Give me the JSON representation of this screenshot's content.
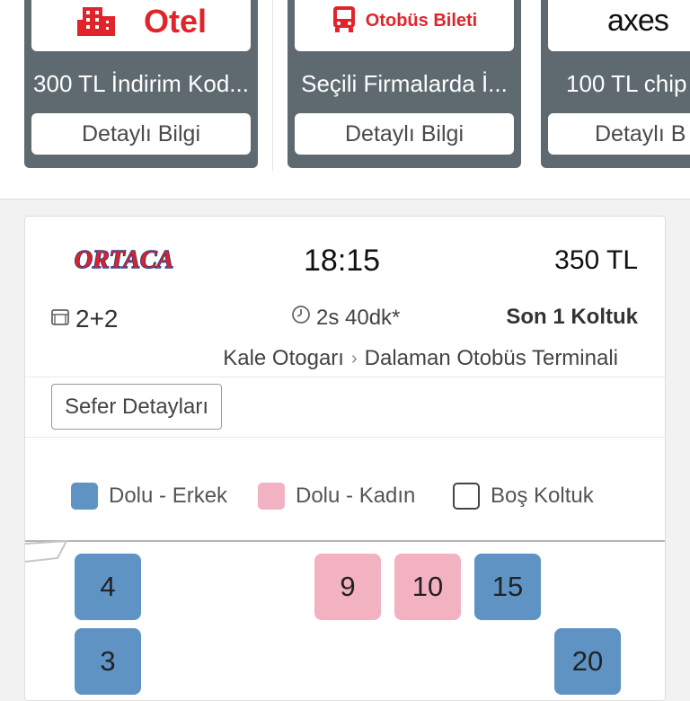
{
  "promos": [
    {
      "logo_text": "Otel",
      "title": "300 TL İndirim Kod...",
      "button": "Detaylı Bilgi"
    },
    {
      "logo_text": "Otobüs Bileti",
      "title": "Seçili Firmalarda İ...",
      "button": "Detaylı Bilgi"
    },
    {
      "logo_text": "axes",
      "title": "100 TL chip",
      "button": "Detaylı B"
    }
  ],
  "trip": {
    "company": "ORTACA",
    "departure_time": "18:15",
    "price": "350 TL",
    "seat_layout": "2+2",
    "duration": "2s 40dk*",
    "seats_left": "Son 1 Koltuk",
    "origin": "Kale Otogarı",
    "destination": "Dalaman Otobüs Terminali",
    "details_button": "Sefer Detayları"
  },
  "legend": {
    "male": "Dolu - Erkek",
    "female": "Dolu - Kadın",
    "empty": "Boş Koltuk"
  },
  "seats": [
    {
      "number": "4",
      "status": "male"
    },
    {
      "number": "9",
      "status": "female"
    },
    {
      "number": "10",
      "status": "female"
    },
    {
      "number": "15",
      "status": "male"
    },
    {
      "number": "3",
      "status": "male"
    },
    {
      "number": "20",
      "status": "male"
    }
  ],
  "colors": {
    "male": "#5e93c4",
    "female": "#f2b2c1",
    "brand_red": "#e1242c",
    "promo_card": "#5f6a70"
  }
}
